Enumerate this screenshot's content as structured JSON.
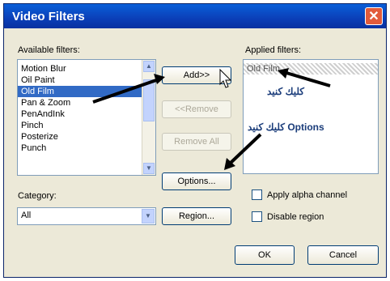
{
  "window": {
    "title": "Video Filters",
    "close_symbol": "✕"
  },
  "available": {
    "label": "Available filters:",
    "items": [
      "Motion Blur",
      "Oil Paint",
      "Old Film",
      "Pan & Zoom",
      "PenAndInk",
      "Pinch",
      "Posterize",
      "Punch"
    ],
    "selected": "Old Film"
  },
  "applied": {
    "label": "Applied filters:",
    "items": [
      "Old Film"
    ]
  },
  "buttons": {
    "add": "Add>>",
    "remove": "<<Remove",
    "remove_all": "Remove All",
    "options": "Options...",
    "region": "Region...",
    "ok": "OK",
    "cancel": "Cancel"
  },
  "category": {
    "label": "Category:",
    "value": "All"
  },
  "checkboxes": {
    "alpha": "Apply alpha channel",
    "disable_region": "Disable region"
  },
  "annotations": {
    "line1": "كليك كنيد",
    "line2": "Options كليك كنيد"
  },
  "colors": {
    "selection": "#316ac5",
    "titlebar": "#0b3fb8",
    "dialog": "#ece9d8"
  },
  "icons": [
    "close-icon",
    "scroll-up-icon",
    "scroll-down-icon",
    "dropdown-arrow-icon",
    "mouse-cursor-icon",
    "annotation-arrow-icon"
  ]
}
